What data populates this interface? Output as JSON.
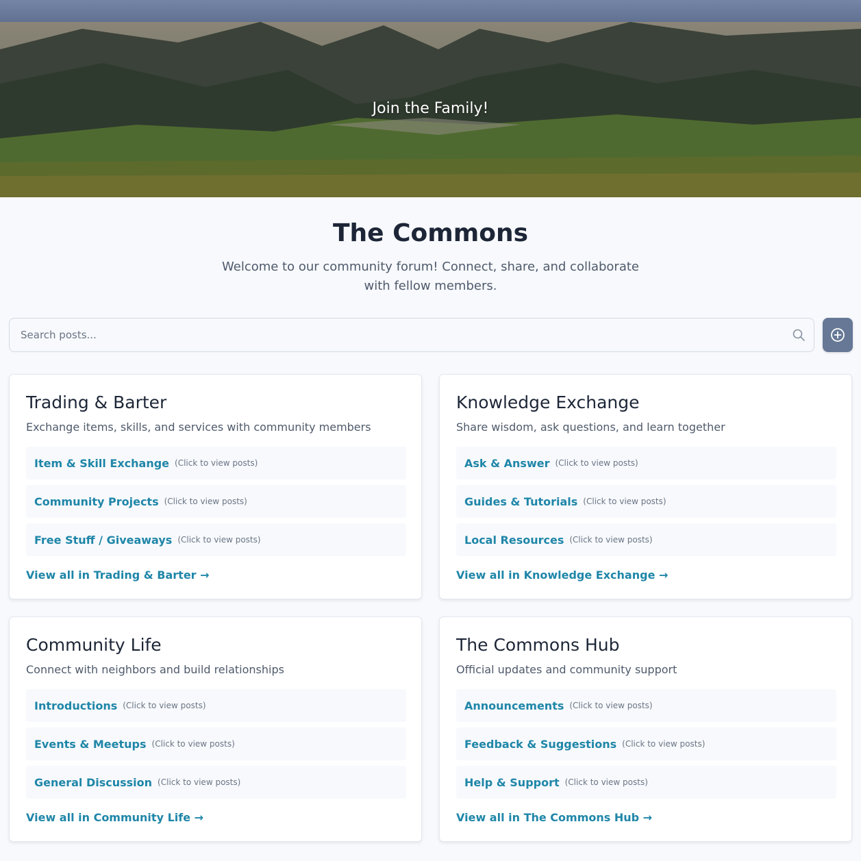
{
  "hero": {
    "title": "Join the Family!"
  },
  "page": {
    "title": "The Commons",
    "subtitle": "Welcome to our community forum! Connect, share, and collaborate with fellow members."
  },
  "search": {
    "placeholder": "Search posts...",
    "icon": "search-icon"
  },
  "add_button": {
    "icon": "plus-circle-icon"
  },
  "colors": {
    "accent": "#1f86a8",
    "button": "#667896",
    "background": "#f7f9fc"
  },
  "categories": [
    {
      "title": "Trading & Barter",
      "description": "Exchange items, skills, and services with community members",
      "subforums": [
        {
          "name": "Item & Skill Exchange",
          "hint": "(Click to view posts)"
        },
        {
          "name": "Community Projects",
          "hint": "(Click to view posts)"
        },
        {
          "name": "Free Stuff / Giveaways",
          "hint": "(Click to view posts)"
        }
      ],
      "view_all": "View all in Trading & Barter →"
    },
    {
      "title": "Knowledge Exchange",
      "description": "Share wisdom, ask questions, and learn together",
      "subforums": [
        {
          "name": "Ask & Answer",
          "hint": "(Click to view posts)"
        },
        {
          "name": "Guides & Tutorials",
          "hint": "(Click to view posts)"
        },
        {
          "name": "Local Resources",
          "hint": "(Click to view posts)"
        }
      ],
      "view_all": "View all in Knowledge Exchange →"
    },
    {
      "title": "Community Life",
      "description": "Connect with neighbors and build relationships",
      "subforums": [
        {
          "name": "Introductions",
          "hint": "(Click to view posts)"
        },
        {
          "name": "Events & Meetups",
          "hint": "(Click to view posts)"
        },
        {
          "name": "General Discussion",
          "hint": "(Click to view posts)"
        }
      ],
      "view_all": "View all in Community Life →"
    },
    {
      "title": "The Commons Hub",
      "description": "Official updates and community support",
      "subforums": [
        {
          "name": "Announcements",
          "hint": "(Click to view posts)"
        },
        {
          "name": "Feedback & Suggestions",
          "hint": "(Click to view posts)"
        },
        {
          "name": "Help & Support",
          "hint": "(Click to view posts)"
        }
      ],
      "view_all": "View all in The Commons Hub →"
    }
  ]
}
